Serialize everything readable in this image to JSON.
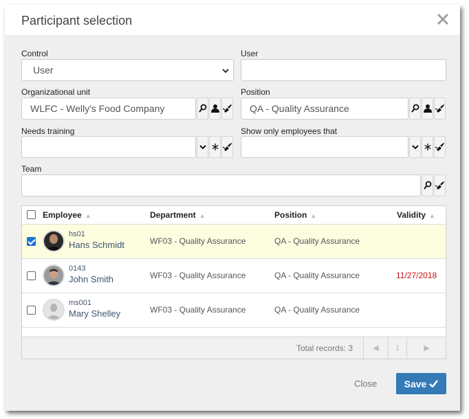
{
  "dialog": {
    "title": "Participant selection",
    "close_icon": "close-icon"
  },
  "form": {
    "control": {
      "label": "Control",
      "value": "User"
    },
    "user": {
      "label": "User",
      "value": ""
    },
    "org_unit": {
      "label": "Organizational unit",
      "value": "WLFC - Welly's Food Company"
    },
    "position": {
      "label": "Position",
      "value": "QA - Quality Assurance"
    },
    "needs_training": {
      "label": "Needs training",
      "value": ""
    },
    "show_only": {
      "label": "Show only employees that",
      "value": ""
    },
    "team": {
      "label": "Team",
      "value": ""
    }
  },
  "grid": {
    "columns": [
      "Employee",
      "Department",
      "Position",
      "Validity"
    ],
    "rows": [
      {
        "checked": true,
        "code": "hs01",
        "name": "Hans Schmidt",
        "department": "WF03 - Quality Assurance",
        "position": "QA - Quality Assurance",
        "validity": ""
      },
      {
        "checked": false,
        "code": "0143",
        "name": "John Smith",
        "department": "WF03 - Quality Assurance",
        "position": "QA - Quality Assurance",
        "validity": "11/27/2018"
      },
      {
        "checked": false,
        "code": "ms001",
        "name": "Mary Shelley",
        "department": "WF03 - Quality Assurance",
        "position": "QA - Quality Assurance",
        "validity": ""
      }
    ],
    "total_records": "Total records: 3",
    "page": "1"
  },
  "footer": {
    "close_label": "Close",
    "save_label": "Save"
  },
  "colors": {
    "accent": "#337ab7",
    "selected_row": "#fdfde0",
    "expired": "#cc1111"
  }
}
